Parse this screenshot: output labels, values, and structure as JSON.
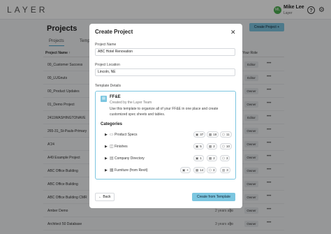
{
  "app": {
    "logo": "LAYER"
  },
  "user": {
    "initials": "ML",
    "name": "Mike Lee",
    "org": "Layer"
  },
  "page": {
    "title": "Projects",
    "create_button": "Create Project +",
    "tabs": [
      "Projects",
      "Templ"
    ],
    "columns": {
      "name": "Project Name ↑",
      "role": "Your Role"
    }
  },
  "rows": [
    {
      "name": "00_Customer Success",
      "date": "",
      "role": "Editor"
    },
    {
      "name": "00_LUGnuts",
      "date": "",
      "role": "Editor"
    },
    {
      "name": "00_Product Updates",
      "date": "",
      "role": "Owner"
    },
    {
      "name": "01_Demo Project",
      "date": "",
      "role": "Owner"
    },
    {
      "name": "2411WASHINGTONAVE",
      "date": "",
      "role": "Editor"
    },
    {
      "name": "265-31_St-Pauls-Primary",
      "date": "",
      "role": "Owner"
    },
    {
      "name": "A'24",
      "date": "",
      "role": "Owner"
    },
    {
      "name": "A49 Example Project",
      "date": "",
      "role": "Owner"
    },
    {
      "name": "ABC Office Building",
      "date": "",
      "role": "Owner"
    },
    {
      "name": "ABC Office Building",
      "date": "",
      "role": "Owner"
    },
    {
      "name": "ABC Office Building CMR",
      "date": "",
      "role": "Owner"
    },
    {
      "name": "Amber Demo",
      "date": "2 years ago",
      "role": "Owner"
    },
    {
      "name": "Architect 50 Database",
      "date": "3 years ago",
      "role": "Owner"
    }
  ],
  "modal": {
    "title": "Create Project",
    "name_label": "Project Name",
    "name_value": "ABC Hotel Renovation",
    "location_label": "Project Location",
    "location_value": "Lincoln, NE",
    "details_label": "Template Details",
    "template": {
      "name": "FF&E",
      "by": "Created by the Layer Team",
      "description": "Use this template to organize all of your FF&E in one place and create customized spec sheets and tables.",
      "categories_title": "Categories",
      "categories": [
        {
          "name": "Product Specs",
          "badges": [
            "37",
            "18",
            "11"
          ]
        },
        {
          "name": "Finishes",
          "badges": [
            "5",
            "2",
            "10"
          ]
        },
        {
          "name": "Company Directory",
          "badges": [
            "1",
            "2",
            "3"
          ]
        },
        {
          "name": "Furniture (from Revit)",
          "badges": [
            "+",
            "14",
            "3",
            "3"
          ]
        }
      ]
    },
    "back": "Back",
    "submit": "Create from Template"
  },
  "colors": {
    "accent": "#7cc6e0",
    "avatar": "#4caf50"
  }
}
